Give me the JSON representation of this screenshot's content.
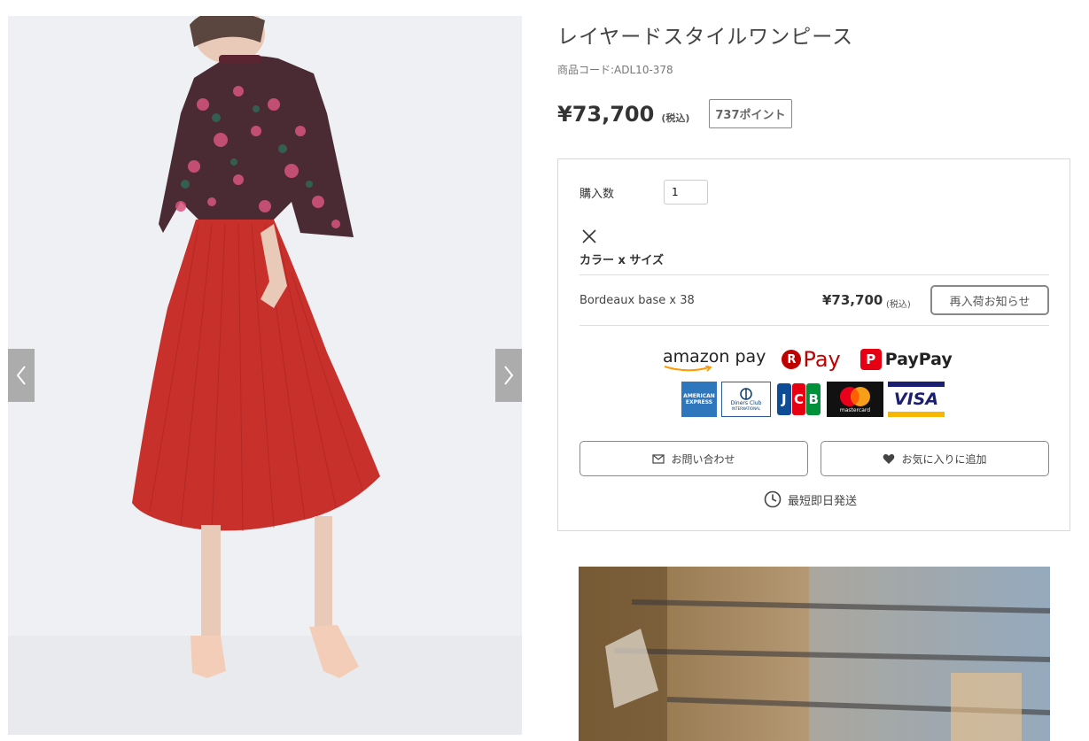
{
  "product": {
    "title": "レイヤードスタイルワンピース",
    "code": "商品コード:ADL10-378",
    "price": "¥73,700",
    "tax_label": "(税込)",
    "points": "737ポイント"
  },
  "gallery": {
    "prev_icon": "chevron-left-icon",
    "next_icon": "chevron-right-icon"
  },
  "purchase": {
    "quantity_label": "購入数",
    "quantity_value": "1",
    "close_icon": "close-icon",
    "variant_heading": "カラー x サイズ",
    "variants": [
      {
        "name": "Bordeaux base x 38",
        "price": "¥73,700",
        "tax_label": "(税込)",
        "action_label": "再入荷お知らせ"
      }
    ]
  },
  "payments": {
    "amazon_pay": "amazon pay",
    "rakuten_pay": "Pay",
    "rakuten_mark": "R",
    "paypay": "PayPay",
    "paypay_mark": "P",
    "cards": {
      "amex": "AMERICAN EXPRESS",
      "diners": "Diners Club",
      "diners_sub": "INTERNATIONAL",
      "jcb": [
        "J",
        "C",
        "B"
      ],
      "mastercard": "mastercard",
      "visa": "VISA"
    }
  },
  "actions": {
    "contact_label": "お問い合わせ",
    "favorite_label": "お気に入りに追加",
    "shipping_label": "最短即日発送"
  },
  "colors": {
    "rakuten_red": "#bf0000",
    "paypay_red": "#e60012",
    "amex_blue": "#2e77bc",
    "visa_navy": "#1a1f71",
    "visa_gold": "#f7b600",
    "jcb_blue": "#0e4c96",
    "jcb_red": "#e60012",
    "jcb_green": "#00913a"
  }
}
